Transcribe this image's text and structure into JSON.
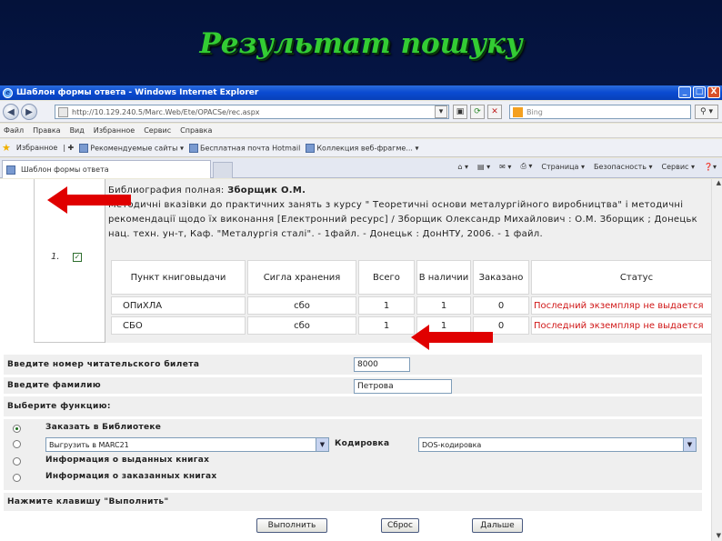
{
  "slide": {
    "title": "Результат пошуку"
  },
  "window": {
    "title": "Шаблон формы ответа - Windows Internet Explorer",
    "controls": {
      "minimize": "_",
      "maximize": "□",
      "close": "X"
    }
  },
  "address": {
    "url": "http://10.129.240.5/Marc.Web/Ete/OPACSe/rec.aspx",
    "search_placeholder": "Bing"
  },
  "menu": [
    "Файл",
    "Правка",
    "Вид",
    "Избранное",
    "Сервис",
    "Справка"
  ],
  "favorites": {
    "label": "Избранное",
    "items": [
      "Рекомендуемые сайты",
      "Бесплатная почта Hotmail",
      "Коллекция веб-фрагме..."
    ]
  },
  "tab": {
    "label": "Шаблон формы ответа"
  },
  "commands": [
    "Страница",
    "Безопасность",
    "Сервис"
  ],
  "result": {
    "number": "1.",
    "checkbox": "✓",
    "bib_title_label": "Библиография полная:",
    "bib_author": "Зборщик О.М.",
    "bib_line1": "Методичні вказівки до практичних занять з курсу \" Теоретичні основи металургійного виробництва\" і методичні",
    "bib_line2": "рекомендації щодо їх виконання [Електронний ресурс] / Зборщик Олександр Михайлович : О.М. Зборщик ; Донецьк",
    "bib_line3": "нац. техн. ун-т, Каф. \"Металургія сталі\". - 1файл. - Донецьк : ДонНТУ, 2006. - 1 файл.",
    "table": {
      "headers": [
        "Пункт книговыдачи",
        "Сигла хранения",
        "Всего",
        "В наличии",
        "Заказано",
        "Статус"
      ],
      "rows": [
        [
          "ОПиХЛА",
          "сбо",
          "1",
          "1",
          "0",
          "Последний экземпляр не выдается"
        ],
        [
          "СБО",
          "сбо",
          "1",
          "1",
          "0",
          "Последний экземпляр не выдается"
        ]
      ]
    }
  },
  "form": {
    "card_label": "Введите номер читательского билета",
    "card_value": "8000",
    "surname_label": "Введите фамилию",
    "surname_value": "Петрова",
    "function_label": "Выберите функцию:",
    "options": [
      {
        "label": "Заказать в Библиотеке",
        "checked": true
      },
      {
        "label": "",
        "checked": false
      },
      {
        "label": "Информация о выданных книгах",
        "checked": false
      },
      {
        "label": "Информация о заказанных книгах",
        "checked": false
      }
    ],
    "export_select": "Выгрузить в MARC21",
    "encoding_label": "Кодировка",
    "encoding_select": "DOS-кодировка",
    "execute_label": "Нажмите клавишу \"Выполнить\"",
    "buttons": {
      "execute": "Выполнить",
      "reset": "Сброс",
      "next": "Дальше"
    }
  },
  "colors": {
    "accent_title": "#33cc33",
    "status_red": "#d01818",
    "arrow_red": "#e00000"
  }
}
